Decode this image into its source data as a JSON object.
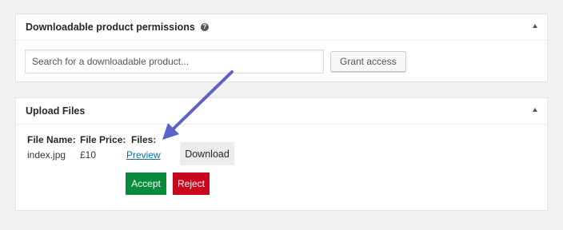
{
  "permissions_panel": {
    "title": "Downloadable product permissions",
    "help_icon": "?",
    "search_placeholder": "Search for a downloadable product...",
    "grant_label": "Grant access"
  },
  "upload_panel": {
    "title": "Upload Files",
    "columns": [
      "File Name:",
      "File Price:",
      "Files:"
    ],
    "row": {
      "file_name": "index.jpg",
      "file_price": "£10",
      "preview_label": "Preview"
    },
    "download_label": "Download",
    "accept_label": "Accept",
    "reject_label": "Reject"
  },
  "colors": {
    "accent_arrow": "#5b63c9",
    "accept": "#058b3b",
    "reject": "#c8061d",
    "link": "#0073aa"
  },
  "icons": [
    "help-icon",
    "collapse-toggle-icon",
    "annotation-arrow-icon"
  ]
}
